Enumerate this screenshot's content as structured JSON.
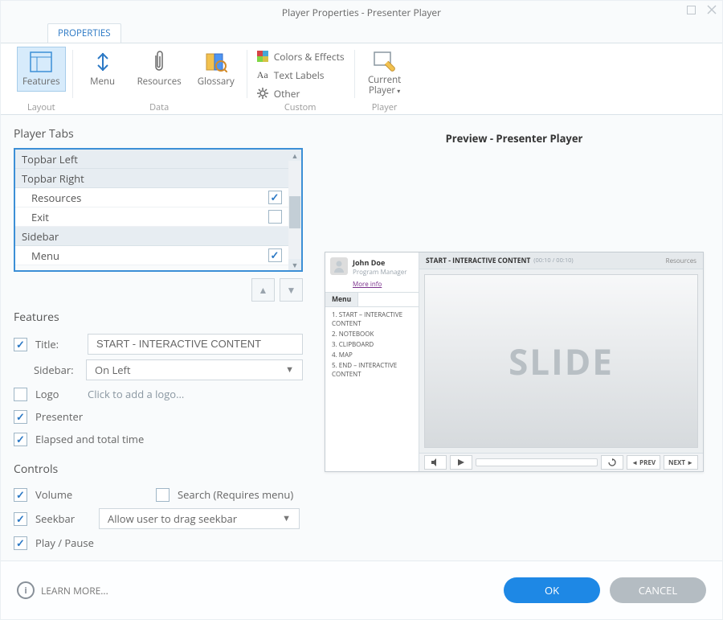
{
  "window": {
    "title": "Player Properties - Presenter Player"
  },
  "tabs": {
    "properties": "PROPERTIES"
  },
  "ribbon": {
    "layout": {
      "features": "Features",
      "group": "Layout"
    },
    "data": {
      "menu": "Menu",
      "resources": "Resources",
      "glossary": "Glossary",
      "group": "Data"
    },
    "custom": {
      "colors": "Colors & Effects",
      "textlabels": "Text Labels",
      "other": "Other",
      "group": "Custom"
    },
    "player": {
      "current": "Current\nPlayer",
      "currentL1": "Current",
      "currentL2": "Player",
      "group": "Player"
    }
  },
  "playerTabs": {
    "heading": "Player Tabs",
    "rows": {
      "topbarLeft": "Topbar Left",
      "topbarRight": "Topbar Right",
      "resources": "Resources",
      "exit": "Exit",
      "sidebar": "Sidebar",
      "menu": "Menu"
    }
  },
  "features": {
    "heading": "Features",
    "titleLabel": "Title:",
    "titleValue": "START - INTERACTIVE CONTENT",
    "sidebarLabel": "Sidebar:",
    "sidebarValue": "On Left",
    "logo": "Logo",
    "logoHint": "Click to add a logo...",
    "presenter": "Presenter",
    "elapsed": "Elapsed and total time"
  },
  "controls": {
    "heading": "Controls",
    "volume": "Volume",
    "search": "Search (Requires menu)",
    "seekbar": "Seekbar",
    "seekValue": "Allow user to drag seekbar",
    "play": "Play / Pause"
  },
  "preview": {
    "heading": "Preview - Presenter Player",
    "person": {
      "name": "John Doe",
      "role": "Program Manager",
      "more": "More info"
    },
    "menuTab": "Menu",
    "menuItems": [
      "1. START – INTERACTIVE CONTENT",
      "2. NOTEBOOK",
      "3. CLIPBOARD",
      "4. MAP",
      "5. END – INTERACTIVE CONTENT"
    ],
    "slideTitle": "START - INTERACTIVE CONTENT",
    "timecode": "(00:10 / 00:10)",
    "resources": "Resources",
    "slide": "SLIDE",
    "prev": "◄  PREV",
    "next": "NEXT  ►"
  },
  "footer": {
    "learn": "LEARN MORE...",
    "ok": "OK",
    "cancel": "CANCEL"
  }
}
